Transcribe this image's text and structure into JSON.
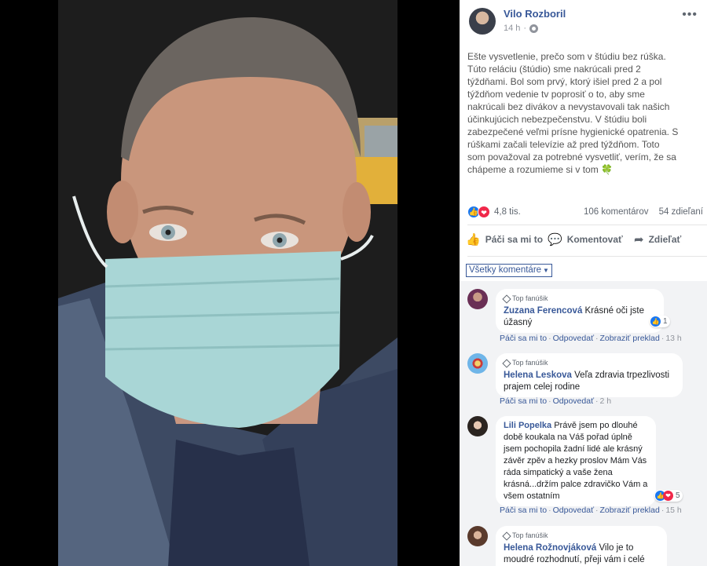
{
  "post": {
    "author": "Vilo Rozboril",
    "time": "14 h",
    "text": "Ešte vysvetlenie, prečo som v štúdiu bez rúška. Túto reláciu (štúdio) sme nakrúcali pred 2 týždňami. Bol som prvý, ktorý išiel pred 2 a pol týždňom vedenie tv poprosiť o to, aby sme nakrúcali bez divákov a nevystavovali tak našich účinkujúcich nebezpečenstvu. V štúdiu boli zabezpečené veľmi prísne hygienické opatrenia. S rúškami začali televízie až pred týždňom. Toto som považoval za potrebné vysvetliť, verím, že sa chápeme a rozumieme si v tom",
    "emoji": "🍀",
    "more_icon": "more-dots-icon"
  },
  "stats": {
    "reactions": "4,8 tis.",
    "comments": "106 komentárov",
    "shares": "54 zdieľaní"
  },
  "actions": {
    "like": "Páči sa mi to",
    "comment": "Komentovať",
    "share": "Zdieľať"
  },
  "filter": "Všetky komentáre",
  "comments": [
    {
      "badge": "Top fanúšik",
      "name": "Zuzana Ferencová",
      "text_line1": "Krásné oči jste",
      "text_line2": "úžasný",
      "reactions": "1",
      "like": "Páči sa mi to",
      "reply": "Odpovedať",
      "translate": "Zobraziť preklad",
      "time": "13 h"
    },
    {
      "badge": "Top fanúšik",
      "name": "Helena Leskova",
      "text_line1": "Veľa zdravia trpezlivosti",
      "text_line2": "prajem celej rodine",
      "like": "Páči sa mi to",
      "reply": "Odpovedať",
      "time": "2 h"
    },
    {
      "name": "Lili Popelka",
      "text_lines": [
        "Právě jsem po dlouhé",
        "době koukala na Váš pořad úplně",
        "jsem pochopila žadní lidé ale krásný",
        "závěr zpěv a hezky proslov Mám Vás",
        "ráda simpatický a vaše žena",
        "krásná...držím palce zdravičko Vám a",
        "všem ostatním"
      ],
      "first_line": "Právě jsem po dlouhé",
      "reactions": "5",
      "like": "Páči sa mi to",
      "reply": "Odpovedať",
      "translate": "Zobraziť preklad",
      "time": "15 h"
    },
    {
      "badge": "Top fanúšik",
      "name": "Helena Rožnovjáková",
      "text_line1": "Vilo je to",
      "text_line2": "moudré rozhodnutí, přeji vám i celé vaši"
    }
  ],
  "colors": {
    "link": "#385898",
    "like": "#1877f2",
    "love": "#f0284a",
    "comments_bg": "#f2f3f5"
  }
}
